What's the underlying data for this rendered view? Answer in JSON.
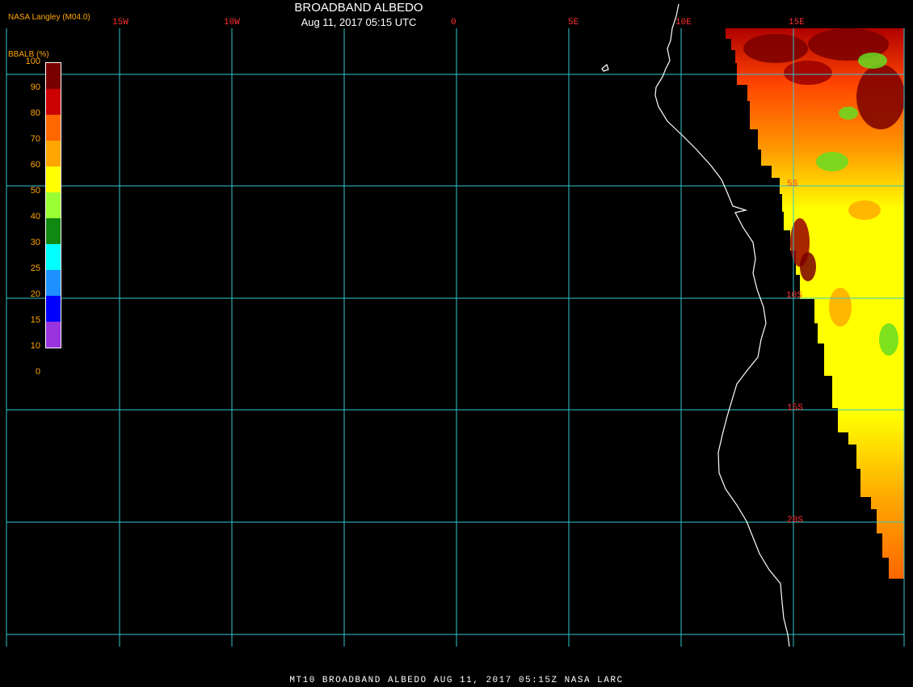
{
  "header": {
    "title": "BROADBAND ALBEDO",
    "subtitle": "Aug 11, 2017 05:15 UTC",
    "credit": "NASA Langley (M04.0)"
  },
  "colorbar": {
    "title": "BBALB (%)",
    "ticks": [
      "100",
      "90",
      "80",
      "70",
      "60",
      "50",
      "40",
      "30",
      "25",
      "20",
      "15",
      "10",
      "0"
    ],
    "colors": [
      "#7a0000",
      "#cc0000",
      "#ff6600",
      "#ffa500",
      "#ffff00",
      "#99ff33",
      "#118811",
      "#00ffff",
      "#1e90ff",
      "#0000ff",
      "#9933dd"
    ]
  },
  "map": {
    "lon_labels": [
      "15W",
      "10W",
      "0",
      "5E",
      "10E",
      "15E"
    ],
    "lat_labels": [
      "5S",
      "10S",
      "15S",
      "20S"
    ],
    "grid_color": "#30c8d0",
    "coast_color": "#ffffff"
  },
  "footer": "MT10  BROADBAND ALBEDO   AUG 11, 2017 05:15Z   NASA LARC"
}
